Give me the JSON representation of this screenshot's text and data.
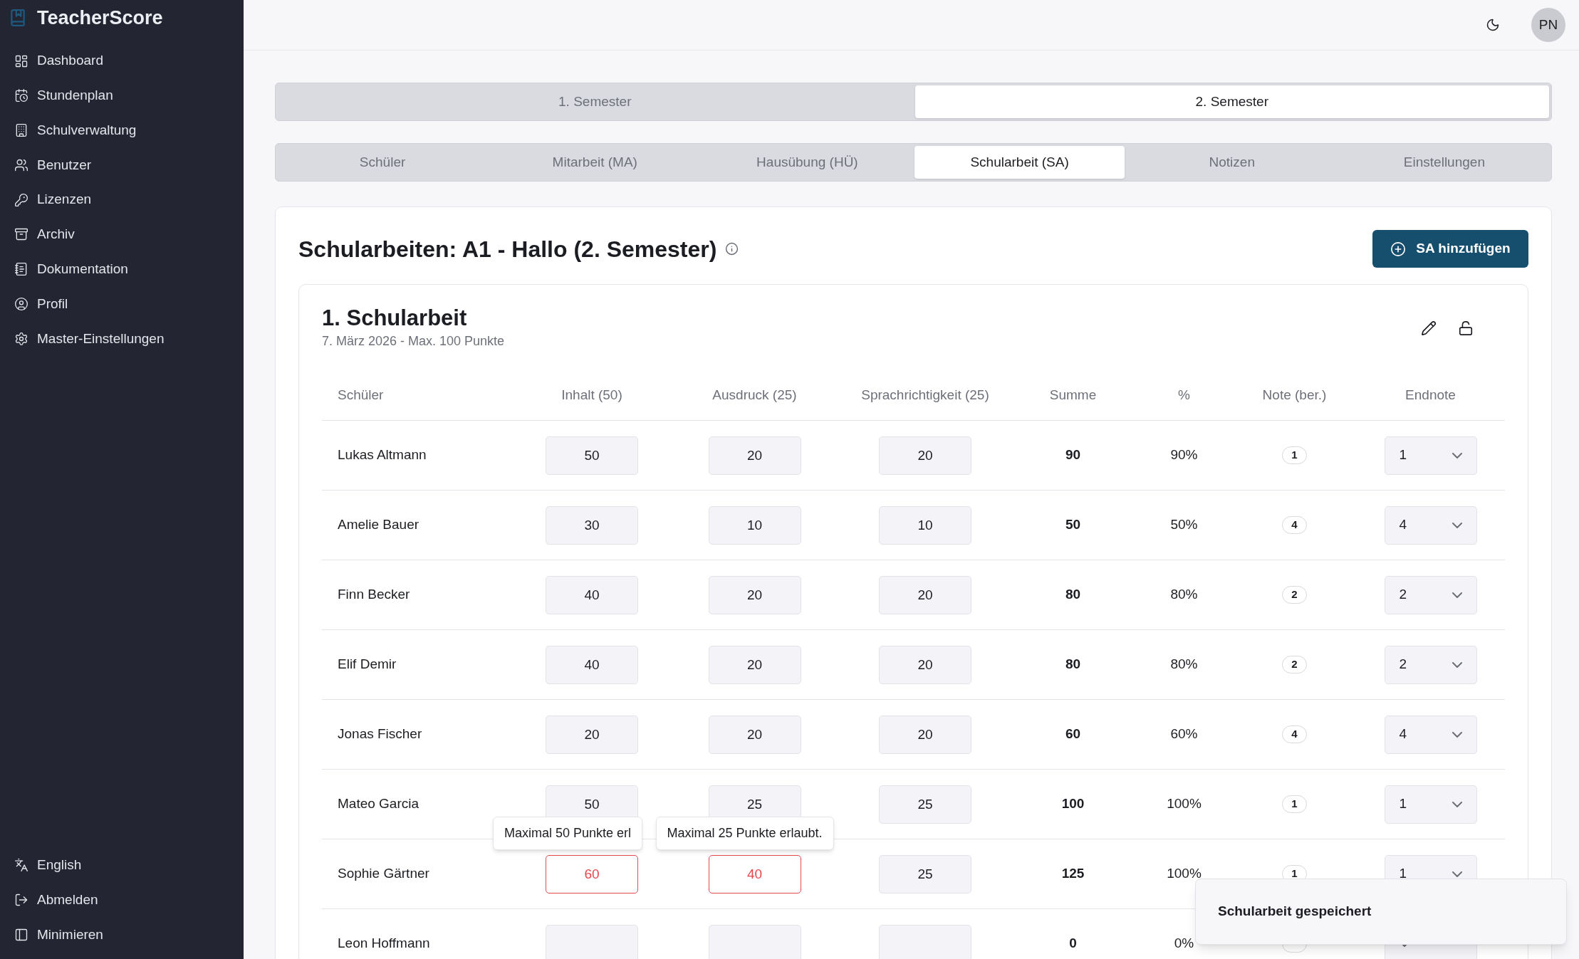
{
  "sidebar": {
    "brand": "TeacherScore",
    "items": [
      "Dashboard",
      "Stundenplan",
      "Schulverwaltung",
      "Benutzer",
      "Lizenzen",
      "Archiv",
      "Dokumentation",
      "Profil",
      "Master-Einstellungen"
    ],
    "footer_items": [
      "English",
      "Abmelden",
      "Minimieren"
    ]
  },
  "header": {
    "avatar": "PN"
  },
  "semester_tabs": [
    {
      "label": "1. Semester",
      "selected": false
    },
    {
      "label": "2. Semester",
      "selected": true
    }
  ],
  "section_tabs": [
    {
      "label": "Schüler",
      "selected": false
    },
    {
      "label": "Mitarbeit (MA)",
      "selected": false
    },
    {
      "label": "Hausübung (HÜ)",
      "selected": false
    },
    {
      "label": "Schularbeit (SA)",
      "selected": true
    },
    {
      "label": "Notizen",
      "selected": false
    },
    {
      "label": "Einstellungen",
      "selected": false
    }
  ],
  "page_title": "Schularbeiten: A1 - Hallo (2. Semester)",
  "add_button": "SA hinzufügen",
  "exam": {
    "title": "1. Schularbeit",
    "subtitle": "7. März 2026 - Max. 100 Punkte",
    "columns": [
      "Schüler",
      "Inhalt (50)",
      "Ausdruck (25)",
      "Sprachrichtigkeit (25)",
      "Summe",
      "%",
      "Note (ber.)",
      "Endnote"
    ],
    "rows": [
      {
        "name": "Lukas Altmann",
        "scores": [
          {
            "value": "50",
            "invalid": false
          },
          {
            "value": "20",
            "invalid": false
          },
          {
            "value": "20",
            "invalid": false
          }
        ],
        "sum": "90",
        "percent": "90%",
        "grade": "1",
        "final": "1"
      },
      {
        "name": "Amelie Bauer",
        "scores": [
          {
            "value": "30",
            "invalid": false
          },
          {
            "value": "10",
            "invalid": false
          },
          {
            "value": "10",
            "invalid": false
          }
        ],
        "sum": "50",
        "percent": "50%",
        "grade": "4",
        "final": "4"
      },
      {
        "name": "Finn Becker",
        "scores": [
          {
            "value": "40",
            "invalid": false
          },
          {
            "value": "20",
            "invalid": false
          },
          {
            "value": "20",
            "invalid": false
          }
        ],
        "sum": "80",
        "percent": "80%",
        "grade": "2",
        "final": "2"
      },
      {
        "name": "Elif Demir",
        "scores": [
          {
            "value": "40",
            "invalid": false
          },
          {
            "value": "20",
            "invalid": false
          },
          {
            "value": "20",
            "invalid": false
          }
        ],
        "sum": "80",
        "percent": "80%",
        "grade": "2",
        "final": "2"
      },
      {
        "name": "Jonas Fischer",
        "scores": [
          {
            "value": "20",
            "invalid": false
          },
          {
            "value": "20",
            "invalid": false
          },
          {
            "value": "20",
            "invalid": false
          }
        ],
        "sum": "60",
        "percent": "60%",
        "grade": "4",
        "final": "4"
      },
      {
        "name": "Mateo Garcia",
        "scores": [
          {
            "value": "50",
            "invalid": false
          },
          {
            "value": "25",
            "invalid": false
          },
          {
            "value": "25",
            "invalid": false
          }
        ],
        "sum": "100",
        "percent": "100%",
        "grade": "1",
        "final": "1"
      },
      {
        "name": "Sophie Gärtner",
        "scores": [
          {
            "value": "60",
            "invalid": true,
            "tooltip": "Maximal 50 Punkte erl"
          },
          {
            "value": "40",
            "invalid": true,
            "tooltip": "Maximal 25 Punkte erlaubt."
          },
          {
            "value": "25",
            "invalid": false
          }
        ],
        "sum": "125",
        "percent": "100%",
        "grade": "1",
        "final": "1"
      },
      {
        "name": "Leon Hoffmann",
        "scores": [
          {
            "invalid": false
          },
          {
            "invalid": false
          },
          {
            "invalid": false
          }
        ],
        "sum": "0",
        "percent": "0%"
      }
    ]
  },
  "toast": "Schularbeit gespeichert"
}
